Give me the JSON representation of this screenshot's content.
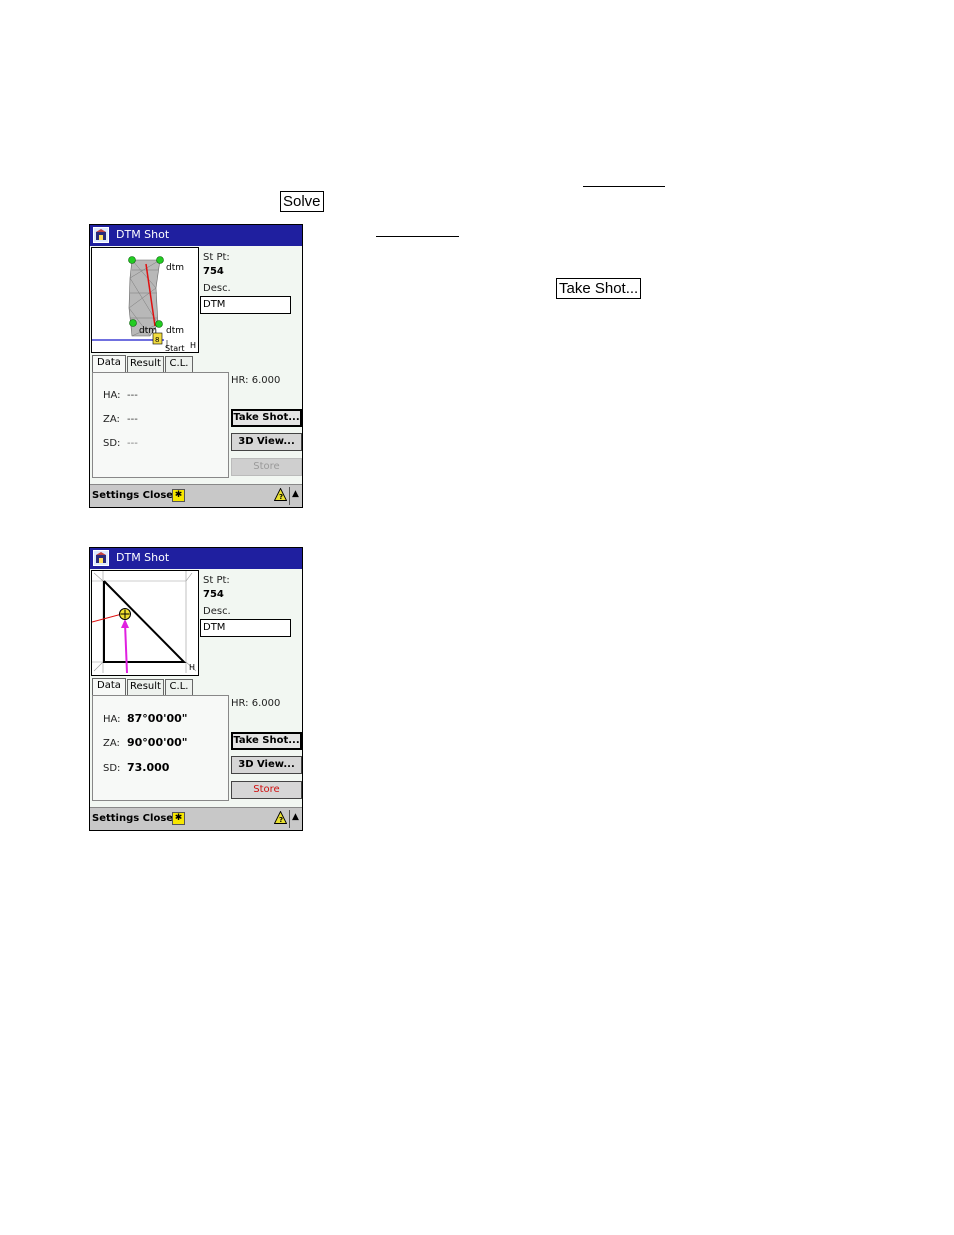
{
  "doc": {
    "solve_button": "Solve",
    "take_shot_button": "Take Shot..."
  },
  "screens": [
    {
      "title": "DTM Shot",
      "st_pt_label": "St Pt:",
      "st_pt_value": "754",
      "desc_label": "Desc.",
      "desc_value": "DTM",
      "plan_labels": {
        "dtm_1": "dtm",
        "dtm_2": "dtm",
        "dtm_3": "dtm",
        "start": "Start",
        "h": "H"
      },
      "tabs": [
        "Data",
        "Result",
        "C.L."
      ],
      "hr": "HR: 6.000",
      "ha_label": "HA:",
      "ha_value": "---",
      "za_label": "ZA:",
      "za_value": "---",
      "sd_label": "SD:",
      "sd_value": "---",
      "buttons": {
        "take_shot": "Take Shot...",
        "view3d": "3D View...",
        "store": "Store"
      },
      "menu": "Settings Close"
    },
    {
      "title": "DTM Shot",
      "st_pt_label": "St Pt:",
      "st_pt_value": "754",
      "desc_label": "Desc.",
      "desc_value": "DTM",
      "plan_labels": {
        "h": "H"
      },
      "tabs": [
        "Data",
        "Result",
        "C.L."
      ],
      "hr": "HR: 6.000",
      "ha_label": "HA:",
      "ha_value": "87°00'00\"",
      "za_label": "ZA:",
      "za_value": "90°00'00\"",
      "sd_label": "SD:",
      "sd_value": "73.000",
      "buttons": {
        "take_shot": "Take Shot...",
        "view3d": "3D View...",
        "store": "Store"
      },
      "menu": "Settings Close"
    }
  ]
}
